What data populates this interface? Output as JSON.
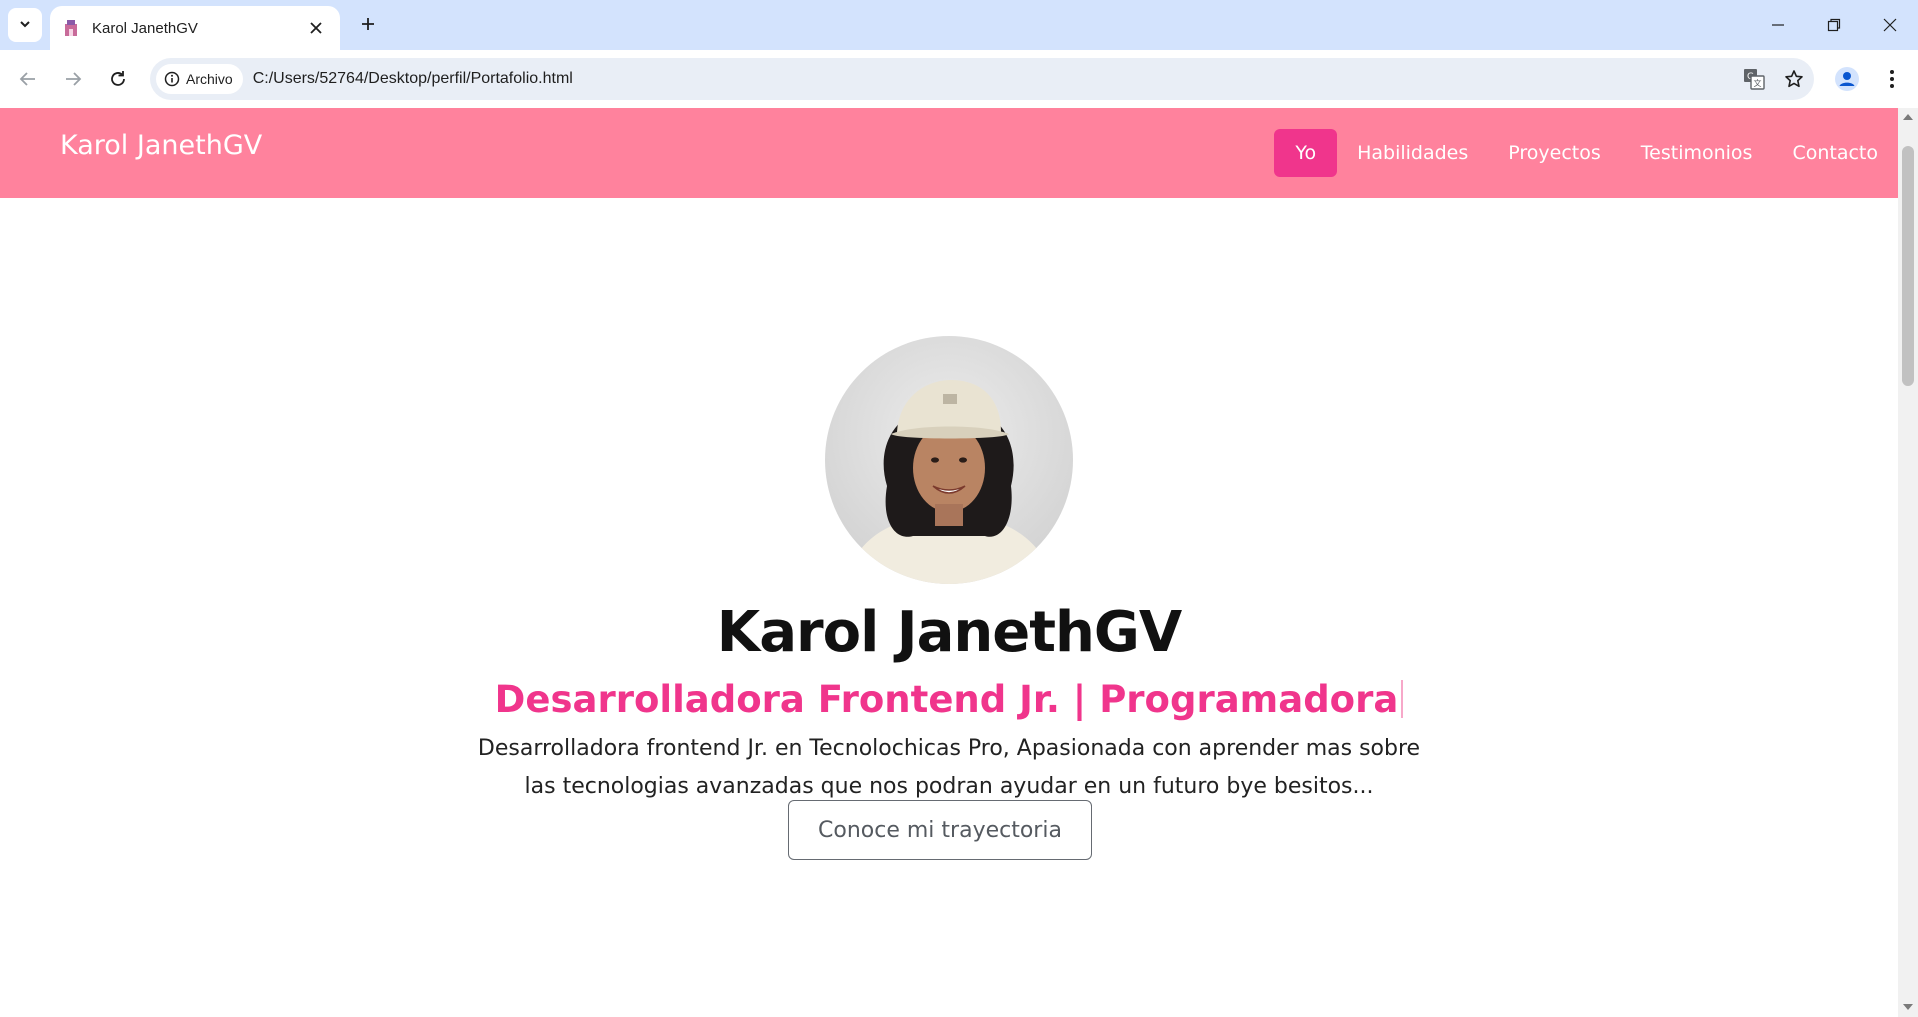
{
  "browser": {
    "tab_title": "Karol JanethGV",
    "site_chip_label": "Archivo",
    "url": "C:/Users/52764/Desktop/perfil/Portafolio.html"
  },
  "site": {
    "brand": "Karol JanethGV",
    "nav": [
      {
        "label": "Yo",
        "active": true
      },
      {
        "label": "Habilidades",
        "active": false
      },
      {
        "label": "Proyectos",
        "active": false
      },
      {
        "label": "Testimonios",
        "active": false
      },
      {
        "label": "Contacto",
        "active": false
      }
    ],
    "accent_color": "#f0358c",
    "navbar_color": "#ff829d"
  },
  "hero": {
    "name": "Karol JanethGV",
    "role": "Desarrolladora Frontend Jr. | Programadora",
    "description": "Desarrolladora frontend Jr. en Tecnolochicas Pro, Apasionada con aprender mas sobre las tecnologias avanzadas que nos podran ayudar en un futuro bye besitos...",
    "cta_label": "Conoce mi trayectoria"
  },
  "icons": {
    "tab_search": "chevron-down-icon",
    "favicon": "castle-favicon-icon",
    "close": "close-icon",
    "new_tab": "plus-icon",
    "back": "arrow-left-icon",
    "forward": "arrow-right-icon",
    "reload": "reload-icon",
    "info": "info-icon",
    "translate": "translate-icon",
    "bookmark": "star-icon",
    "profile": "account-icon",
    "menu": "kebab-menu-icon"
  }
}
